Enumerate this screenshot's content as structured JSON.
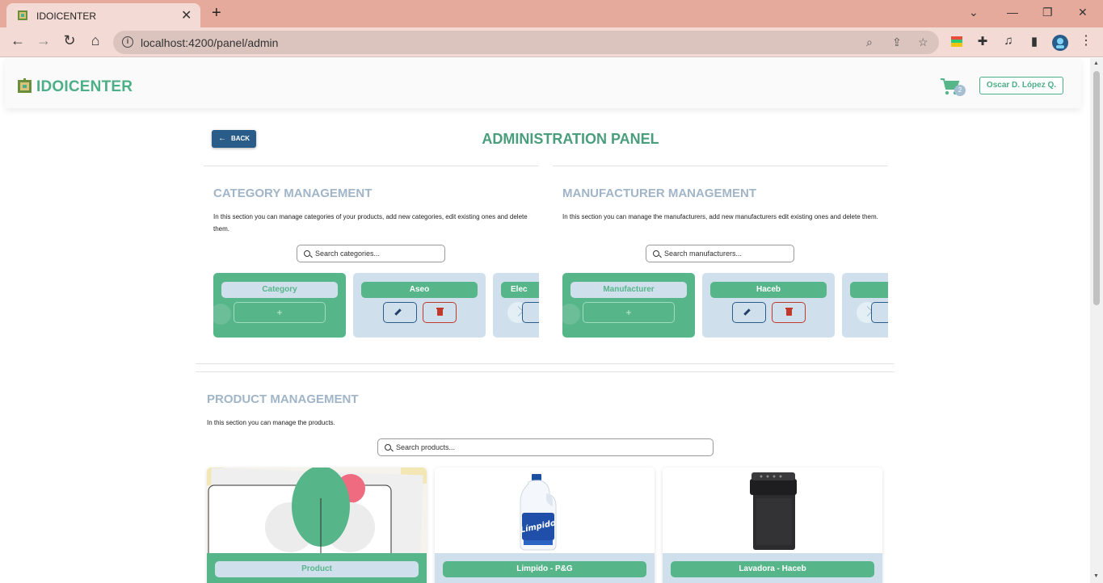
{
  "browser": {
    "tab_title": "IDOICENTER",
    "url": "localhost:4200/panel/admin"
  },
  "header": {
    "brand": "IDOICENTER",
    "cart_count": "2",
    "user_name": "Oscar D. López Q."
  },
  "page": {
    "back_label": "BACK",
    "title": "ADMINISTRATION PANEL"
  },
  "categories": {
    "title": "CATEGORY MANAGEMENT",
    "description": "In this section you can manage categories of your products, add new categories, edit existing ones and delete them.",
    "search_placeholder": "Search categories...",
    "add_card_label": "Category",
    "add_symbol": "+",
    "items": [
      "Aseo",
      "Elec"
    ]
  },
  "manufacturers": {
    "title": "MANUFACTURER MANAGEMENT",
    "description": "In this section you can manage the manufacturers, add new manufacturers edit existing ones and delete them.",
    "search_placeholder": "Search manufacturers...",
    "add_card_label": "Manufacturer",
    "add_symbol": "+",
    "items": [
      "Haceb"
    ]
  },
  "products": {
    "title": "PRODUCT MANAGEMENT",
    "description": "In this section you can manage the products.",
    "search_placeholder": "Search products...",
    "add_card_label": "Product",
    "items": [
      "Limpido - P&G",
      "Lavadora - Haceb"
    ]
  },
  "colors": {
    "brand_green": "#4caf87",
    "card_green": "#57b58a",
    "card_blue": "#cfe0ec",
    "back_blue": "#2a5c8a",
    "section_title": "#a0b5c8"
  }
}
